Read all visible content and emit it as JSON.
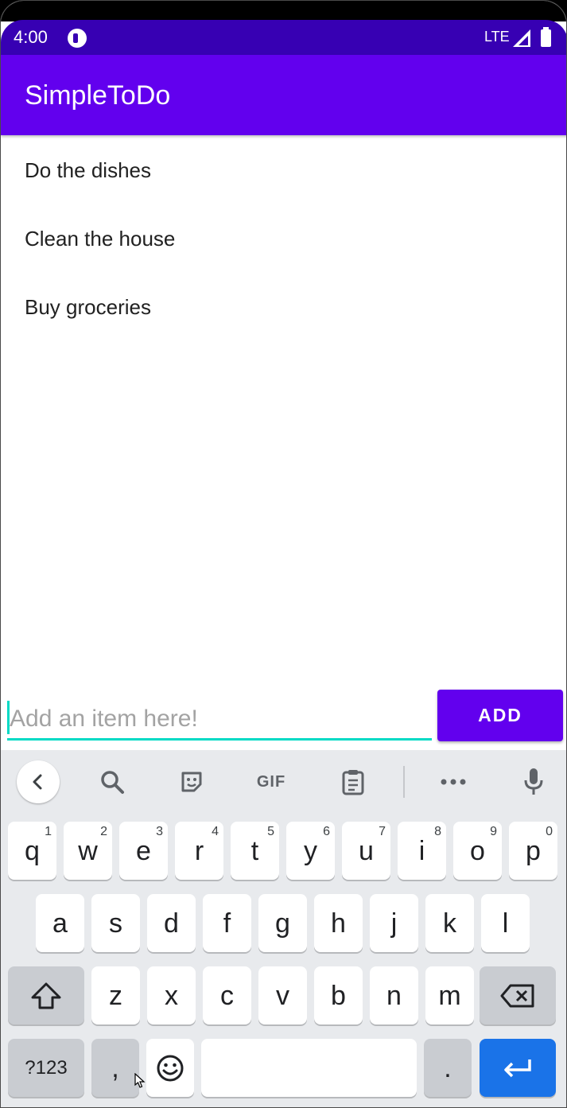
{
  "status_bar": {
    "time": "4:00",
    "network": "LTE"
  },
  "app_bar": {
    "title": "SimpleToDo"
  },
  "todo_items": [
    "Do the dishes",
    "Clean the house",
    "Buy groceries"
  ],
  "input": {
    "placeholder": "Add an item here!",
    "value": ""
  },
  "add_button": {
    "label": "ADD"
  },
  "colors": {
    "primary": "#6200ee",
    "primary_dark": "#3700b3",
    "accent": "#03dac5",
    "keyboard_bg": "#e8eaed",
    "enter_key": "#1a73e8"
  },
  "keyboard": {
    "toolbar": {
      "gif_label": "GIF"
    },
    "row1": [
      {
        "k": "q",
        "h": "1"
      },
      {
        "k": "w",
        "h": "2"
      },
      {
        "k": "e",
        "h": "3"
      },
      {
        "k": "r",
        "h": "4"
      },
      {
        "k": "t",
        "h": "5"
      },
      {
        "k": "y",
        "h": "6"
      },
      {
        "k": "u",
        "h": "7"
      },
      {
        "k": "i",
        "h": "8"
      },
      {
        "k": "o",
        "h": "9"
      },
      {
        "k": "p",
        "h": "0"
      }
    ],
    "row2": [
      "a",
      "s",
      "d",
      "f",
      "g",
      "h",
      "j",
      "k",
      "l"
    ],
    "row3": [
      "z",
      "x",
      "c",
      "v",
      "b",
      "n",
      "m"
    ],
    "symbols_label": "?123",
    "comma_label": ",",
    "period_label": "."
  }
}
